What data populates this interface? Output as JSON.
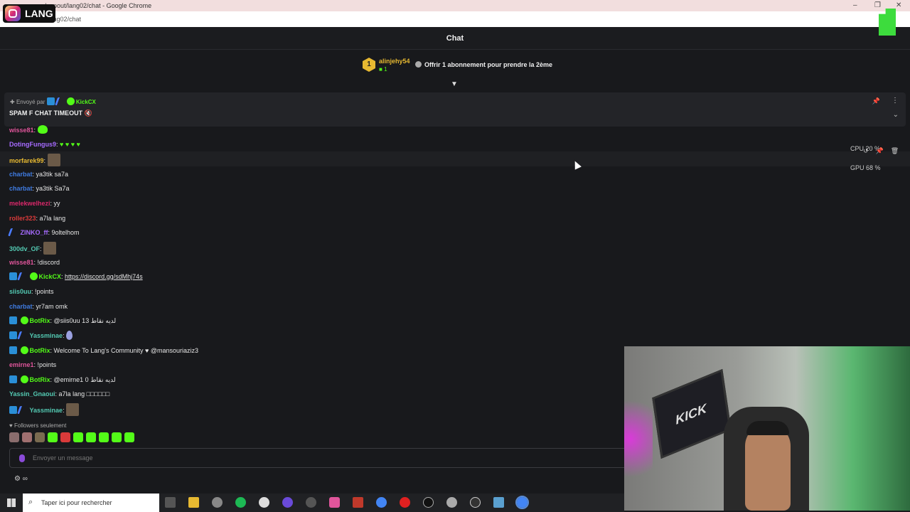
{
  "window": {
    "title": "...com/popout/lang02/chat - Google Chrome",
    "url": "...pout/lang02/chat",
    "logo_text": "LANG"
  },
  "header": {
    "title": "Chat"
  },
  "gift": {
    "rank": "1",
    "username": "alinjehy54",
    "sub_count": "1",
    "offer_text": "Offrir 1 abonnement pour prendre la 2ème"
  },
  "pinned": {
    "sent_by_label": "Envoyé par",
    "sender": "KickCX",
    "message": "SPAM F CHAT TIMEOUT"
  },
  "messages": [
    {
      "user": "wisse81",
      "color": "#e0559b",
      "text": ""
    },
    {
      "user": "DotingFungus9",
      "color": "#a66bff",
      "text": "♥ ♥ ♥ ♥"
    },
    {
      "user": "morfarek99",
      "color": "#e7b931",
      "text": ""
    },
    {
      "user": "charbat",
      "color": "#3f7be0",
      "text": "ya3tik sa7a"
    },
    {
      "user": "charbat",
      "color": "#3f7be0",
      "text": "ya3tik Sa7a"
    },
    {
      "user": "melekwelhezi",
      "color": "#d9286a",
      "text": "yy"
    },
    {
      "user": "roller323",
      "color": "#d93a3a",
      "text": "a7la lang"
    },
    {
      "user": "ZINKO_ff",
      "color": "#a66bff",
      "text": "9oltelhom"
    },
    {
      "user": "300dv_OF",
      "color": "#53c9b2",
      "text": ""
    },
    {
      "user": "wisse81",
      "color": "#e0559b",
      "text": "!discord"
    },
    {
      "user": "KickCX",
      "color": "#53fc18",
      "text": "https://discord.gg/sdMhj74s"
    },
    {
      "user": "siis0uu",
      "color": "#53c9b2",
      "text": "!points"
    },
    {
      "user": "charbat",
      "color": "#3f7be0",
      "text": "yr7am omk"
    },
    {
      "user": "BotRix",
      "color": "#53fc18",
      "text": "@siis0uu 13 لديه نقاط"
    },
    {
      "user": "Yassminae",
      "color": "#53c9b2",
      "text": ""
    },
    {
      "user": "BotRix",
      "color": "#53fc18",
      "text": "Welcome To Lang's Community ♥ @mansouriaziz3"
    },
    {
      "user": "emirne1",
      "color": "#e0559b",
      "text": "!points"
    },
    {
      "user": "BotRix",
      "color": "#53fc18",
      "text": "@emirne1 0 لديه نقاط"
    },
    {
      "user": "Yassin_Gnaoui",
      "color": "#53c9b2",
      "text": "a7la lang □□□□□□"
    },
    {
      "user": "Yassminae",
      "color": "#53c9b2",
      "text": ""
    }
  ],
  "perf": {
    "cpu": "CPU  20 %",
    "gpu": "GPU  68 %"
  },
  "footer": {
    "followers_only": "Followers seulement",
    "input_placeholder": "Envoyer un message",
    "infinity": "∞"
  },
  "taskbar": {
    "search_placeholder": "Taper ici pour rechercher"
  },
  "webcam": {
    "screen_text": "KICK"
  }
}
